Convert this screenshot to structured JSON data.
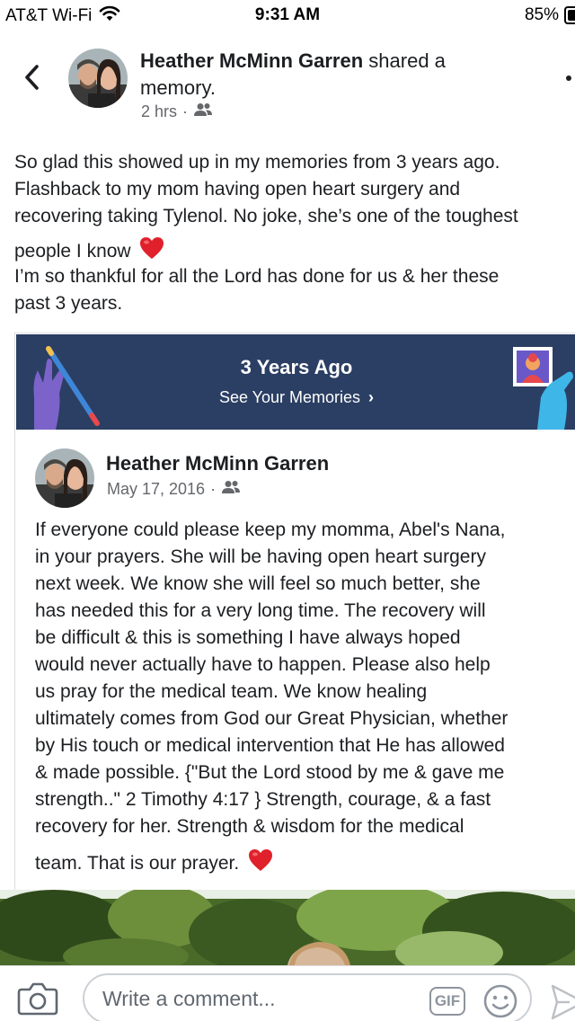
{
  "status_bar": {
    "carrier": "AT&T Wi-Fi",
    "time": "9:31 AM",
    "battery": "85%"
  },
  "header": {
    "author_name": "Heather McMinn Garren",
    "action": "shared a",
    "action_line2": "memory.",
    "time_ago": "2 hrs",
    "separator": "·",
    "audience_icon": "friends-icon"
  },
  "post": {
    "lines": [
      "So glad this showed up in my memories from 3 years ago.",
      "Flashback to my mom having open heart surgery and",
      "recovering taking Tylenol. No joke, she’s one of the toughest",
      "people I know",
      "I’m so thankful for all the Lord has done for us & her these",
      "past 3 years."
    ]
  },
  "memory": {
    "title": "3 Years Ago",
    "link": "See Your Memories",
    "chevron": "›",
    "banner_color": "#2b3e63"
  },
  "shared_post": {
    "author_name": "Heather McMinn Garren",
    "date": "May 17, 2016",
    "separator": "·",
    "lines": [
      "If everyone could please keep my momma, Abel's Nana,",
      "in your prayers. She will be having open heart surgery",
      "next week. We know she will feel so much better, she",
      "has needed this for a very long time. The recovery will",
      "be difficult & this is something I have always hoped",
      "would never actually have to happen. Please also help",
      "us pray for the medical team. We know healing",
      "ultimately comes from God our Great Physician, whether",
      "by His touch or medical intervention that He has allowed",
      "& made possible. {\"But the Lord stood by me & gave me",
      "strength..\" 2 Timothy 4:17 } Strength, courage, & a fast",
      "recovery for her. Strength & wisdom for the medical",
      "team. That is our prayer."
    ]
  },
  "comment_bar": {
    "placeholder": "Write a comment...",
    "gif_label": "GIF"
  },
  "colors": {
    "heart": "#e0202a",
    "meta_text": "#65676b"
  }
}
